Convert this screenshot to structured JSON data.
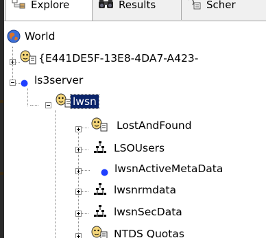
{
  "tabs": [
    {
      "label": "Explore",
      "icon": "tree-structure-icon",
      "active": true
    },
    {
      "label": "Results",
      "icon": "binoculars-icon",
      "active": false
    },
    {
      "label": "Scher",
      "icon": "schema-icon",
      "active": false
    }
  ],
  "tree": {
    "root": {
      "label": "World",
      "icon": "globe-icon"
    },
    "items": [
      {
        "label": "{E441DE5F-13E8-4DA7-A423-",
        "icon": "face-document-icon",
        "expander": "plus"
      },
      {
        "label": "ls3server",
        "icon": "blue-dot-icon",
        "expander": "minus"
      },
      {
        "label": "lwsn",
        "icon": "face-document-icon",
        "expander": "minus",
        "selected": true
      },
      {
        "label": "LostAndFound",
        "icon": "face-document-icon",
        "expander": "plus"
      },
      {
        "label": "LSOUsers",
        "icon": "org-chart-icon",
        "expander": "plus"
      },
      {
        "label": "lwsnActiveMetaData",
        "icon": "blue-dot-icon",
        "expander": "plus"
      },
      {
        "label": "lwsnrmdata",
        "icon": "org-chart-icon",
        "expander": "plus"
      },
      {
        "label": "lwsnSecData",
        "icon": "org-chart-icon",
        "expander": "plus"
      },
      {
        "label": "NTDS Quotas",
        "icon": "face-document-icon",
        "expander": "plus"
      }
    ]
  },
  "colors": {
    "selection_bg": "#0a246a",
    "selection_text": "#ffffff",
    "dot_blue": "#1f3fff",
    "face_yellow": "#f3d57a"
  }
}
